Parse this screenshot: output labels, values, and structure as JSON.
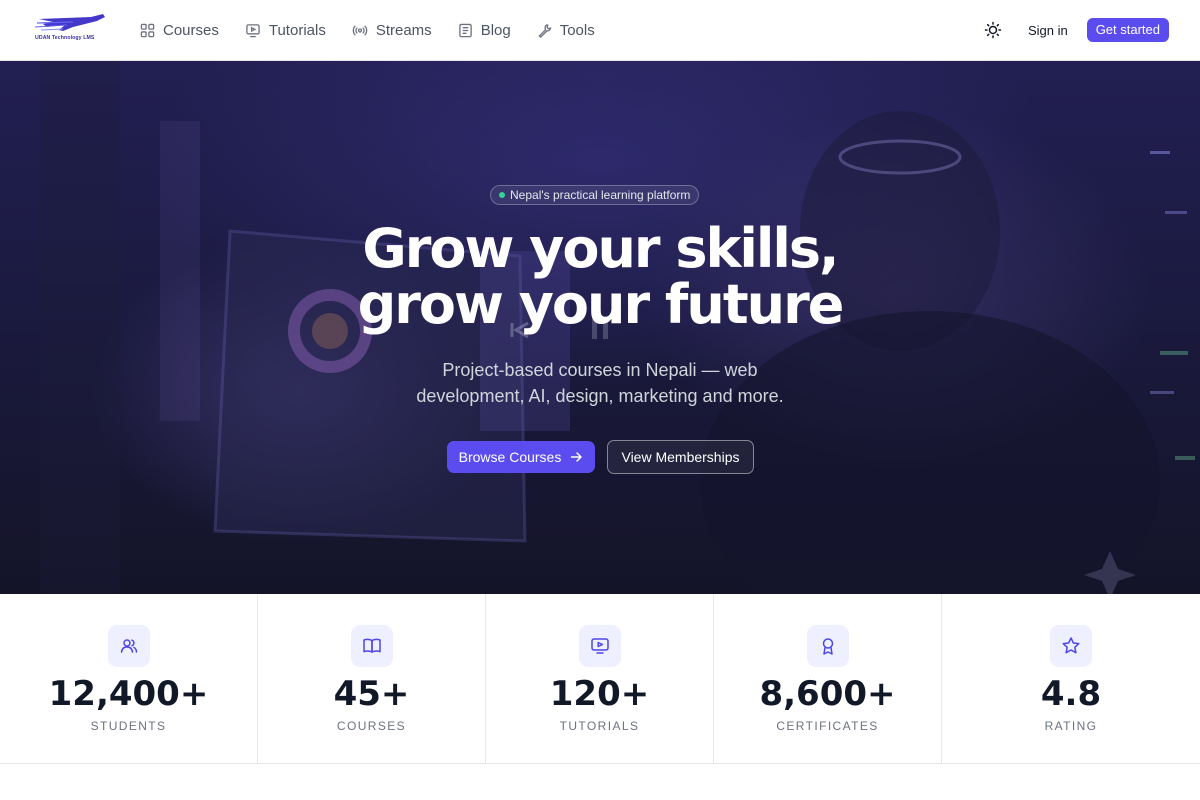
{
  "brand": {
    "logo_text": "UDAN Technology LMS",
    "accent": "#5b4cf0"
  },
  "nav": {
    "items": [
      {
        "label": "Courses",
        "icon": "grid-icon"
      },
      {
        "label": "Tutorials",
        "icon": "monitor-play-icon"
      },
      {
        "label": "Streams",
        "icon": "broadcast-icon"
      },
      {
        "label": "Blog",
        "icon": "newspaper-icon"
      },
      {
        "label": "Tools",
        "icon": "wrench-icon"
      }
    ]
  },
  "header": {
    "theme_icon": "sun-icon",
    "sign_in": "Sign in",
    "get_started": "Get started"
  },
  "hero": {
    "badge": "Nepal's practical learning platform",
    "title_line1": "Grow your skills,",
    "title_line2": "grow your future",
    "subtitle": "Project-based courses in Nepali — web development, AI, design, marketing and more.",
    "primary_cta": "Browse Courses",
    "secondary_cta": "View Memberships"
  },
  "stats": [
    {
      "value": "12,400+",
      "label": "STUDENTS",
      "icon": "users-icon"
    },
    {
      "value": "45+",
      "label": "COURSES",
      "icon": "book-icon"
    },
    {
      "value": "120+",
      "label": "TUTORIALS",
      "icon": "monitor-play-icon"
    },
    {
      "value": "8,600+",
      "label": "CERTIFICATES",
      "icon": "award-icon"
    },
    {
      "value": "4.8",
      "label": "RATING",
      "icon": "star-icon"
    }
  ]
}
